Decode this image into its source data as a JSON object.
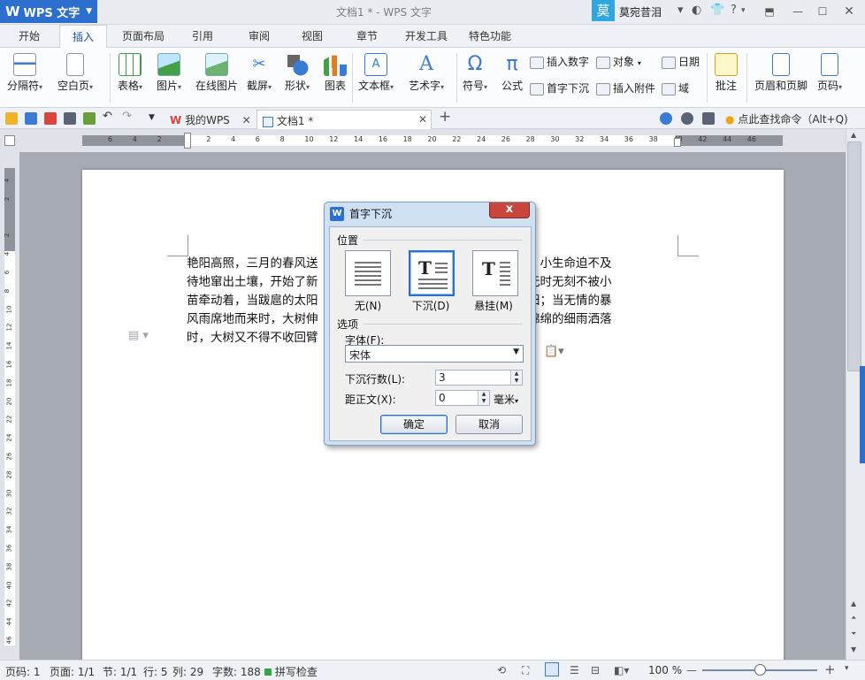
{
  "titlebar": {
    "app_name": "WPS 文字",
    "window_title": "文档1 * - WPS 文字",
    "user_avatar_char": "莫",
    "username": "莫宛昔泪"
  },
  "tabs": [
    "开始",
    "插入",
    "页面布局",
    "引用",
    "审阅",
    "视图",
    "章节",
    "开发工具",
    "特色功能"
  ],
  "active_tab": "插入",
  "ribbon": {
    "page_break": "分隔符",
    "blank_page": "空白页",
    "table": "表格",
    "picture": "图片",
    "online_picture": "在线图片",
    "screenshot": "截屏",
    "shape": "形状",
    "chart": "图表",
    "textbox": "文本框",
    "wordart": "艺术字",
    "symbol": "符号",
    "formula": "公式",
    "insert_number": "插入数字",
    "object": "对象",
    "date": "日期",
    "drop_cap": "首字下沉",
    "attachment": "插入附件",
    "field": "域",
    "comment": "批注",
    "header_footer": "页眉和页脚",
    "page_number": "页码"
  },
  "doc_tabs": {
    "my_wps": "我的WPS",
    "doc1": "文档1 *"
  },
  "search_hint": "点此查找命令（Alt+Q)",
  "ruler_h": [
    "6",
    "4",
    "2",
    "",
    "2",
    "4",
    "6",
    "8",
    "10",
    "12",
    "14",
    "16",
    "18",
    "20",
    "22",
    "24",
    "26",
    "28",
    "30",
    "32",
    "34",
    "36",
    "38",
    "40",
    "42",
    "44",
    "46"
  ],
  "ruler_v": [
    "4",
    "2",
    "",
    "2",
    "4",
    "6",
    "8",
    "10",
    "12",
    "14",
    "16",
    "18",
    "20",
    "22",
    "24",
    "26",
    "28",
    "30",
    "32",
    "34",
    "36",
    "38",
    "40",
    "42",
    "44",
    "46"
  ],
  "document": {
    "lines": [
      "艳阳高照，三月的春风送",
      "待地窜出土壤，开始了新",
      "苗牵动着，当跋扈的太阳",
      "风雨席地而来时，大树伸",
      "时，大树又不得不收回臂"
    ],
    "lines_right": [
      "暴在欢乐中，小生命迫不及",
      "。大树的心无时无刻不被小",
      "小树遮住骄阳；当无情的暴",
      "风来到时，绵绵的细雨洒落",
      ""
    ]
  },
  "dialog": {
    "title": "首字下沉",
    "close": "x",
    "position_label": "位置",
    "options": [
      {
        "label": "无(N)",
        "selected": false
      },
      {
        "label": "下沉(D)",
        "selected": true
      },
      {
        "label": "悬挂(M)",
        "selected": false
      }
    ],
    "options_label": "选项",
    "font_label": "字体(F):",
    "font_value": "宋体",
    "lines_label": "下沉行数(L):",
    "lines_value": "3",
    "distance_label": "距正文(X):",
    "distance_value": "0",
    "distance_unit": "毫米",
    "ok": "确定",
    "cancel": "取消"
  },
  "statusbar": {
    "page_num": "页码: 1",
    "pages": "页面: 1/1",
    "section": "节: 1/1",
    "row": "行: 5",
    "col": "列: 29",
    "words": "字数: 188",
    "spell": "拼写检查",
    "zoom": "100 %"
  },
  "colors": {
    "accent": "#2d6fcf",
    "close_red": "#c9463d"
  }
}
